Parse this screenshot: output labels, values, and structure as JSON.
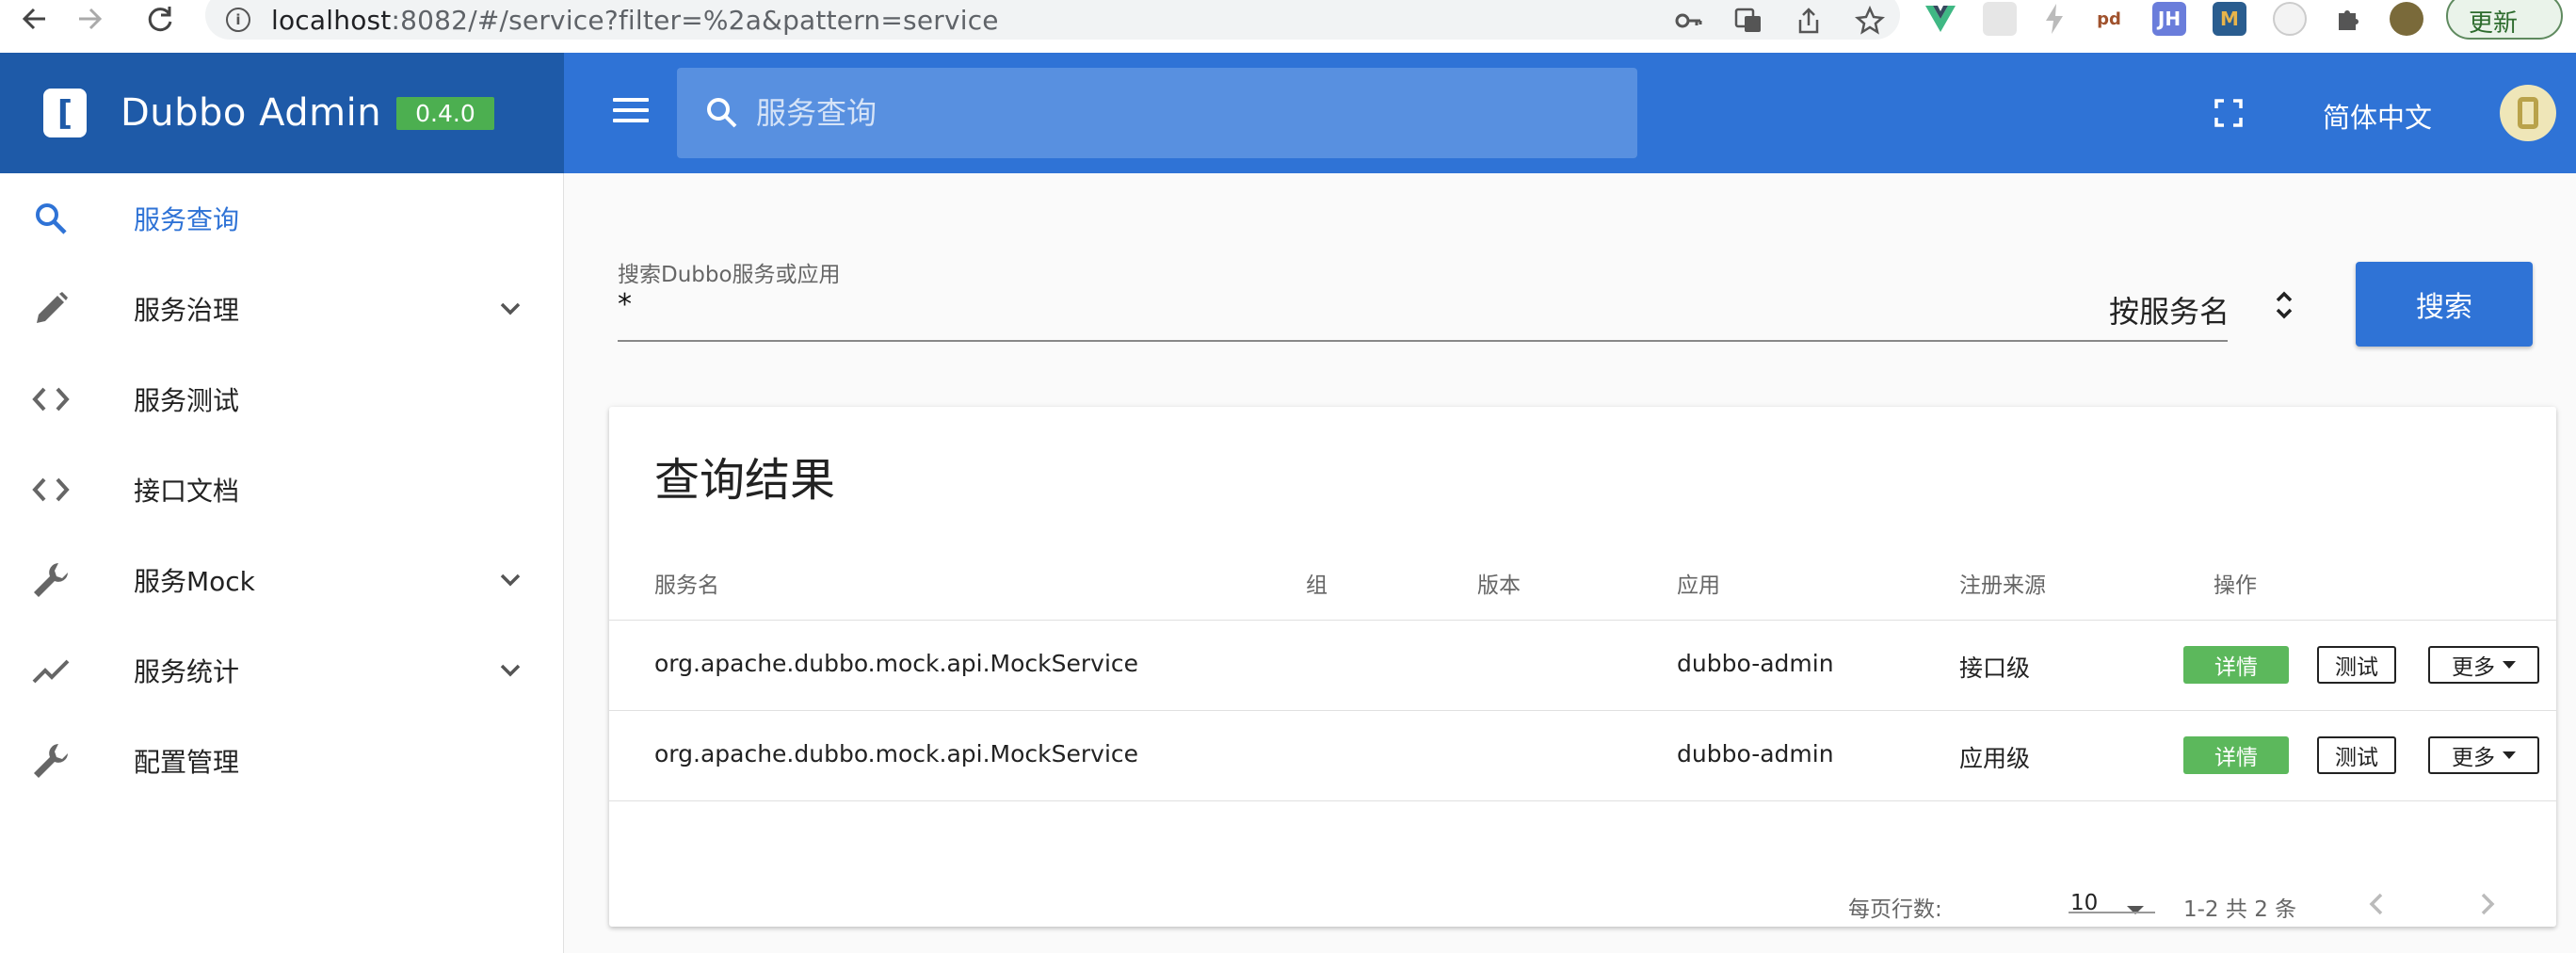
{
  "browser": {
    "url_host": "localhost",
    "url_rest": ":8082/#/service?filter=%2a&pattern=service",
    "extensions": [
      "vue-icon",
      "ext-gray-icon",
      "bolt-icon",
      "ext-leaf-icon",
      "JH",
      "M",
      "ext-circle-icon",
      "puzzle-icon",
      "profile-icon"
    ],
    "update_label": "更新"
  },
  "header": {
    "app_title": "Dubbo Admin",
    "version": "0.4.0",
    "search_placeholder": "服务查询",
    "language": "简体中文",
    "brand_color": "#1e5aa8",
    "bar_color": "#2f73d6"
  },
  "sidebar": {
    "items": [
      {
        "label": "服务查询",
        "icon": "search-icon",
        "active": true,
        "expandable": false
      },
      {
        "label": "服务治理",
        "icon": "pencil-icon",
        "active": false,
        "expandable": true
      },
      {
        "label": "服务测试",
        "icon": "code-icon",
        "active": false,
        "expandable": false
      },
      {
        "label": "接口文档",
        "icon": "code-icon",
        "active": false,
        "expandable": false
      },
      {
        "label": "服务Mock",
        "icon": "wrench-icon",
        "active": false,
        "expandable": true
      },
      {
        "label": "服务统计",
        "icon": "trending-up-icon",
        "active": false,
        "expandable": true
      },
      {
        "label": "配置管理",
        "icon": "wrench-icon",
        "active": false,
        "expandable": false
      }
    ]
  },
  "search": {
    "label": "搜索Dubbo服务或应用",
    "value": "*",
    "mode": "按服务名",
    "button": "搜索"
  },
  "results": {
    "title": "查询结果",
    "columns": [
      "服务名",
      "组",
      "版本",
      "应用",
      "注册来源",
      "操作"
    ],
    "rows": [
      {
        "service": "org.apache.dubbo.mock.api.MockService",
        "group": "",
        "version": "",
        "app": "dubbo-admin",
        "source": "接口级"
      },
      {
        "service": "org.apache.dubbo.mock.api.MockService",
        "group": "",
        "version": "",
        "app": "dubbo-admin",
        "source": "应用级"
      }
    ],
    "actions": {
      "detail": "详情",
      "test": "测试",
      "more": "更多"
    },
    "footer": {
      "rows_per_page_label": "每页行数:",
      "rows_per_page": "10",
      "range": "1-2 共 2 条"
    },
    "detail_color": "#5cb85c"
  }
}
